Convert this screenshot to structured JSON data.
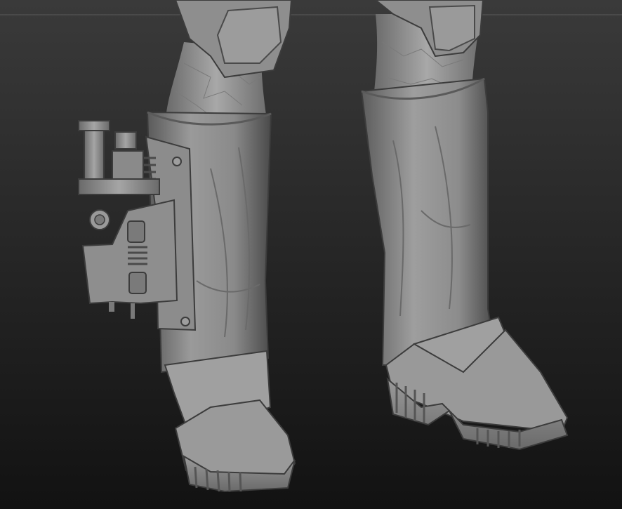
{
  "viewport": {
    "background_top": "#3a3a3a",
    "background_bottom": "#121212",
    "material_base": "#8a8a8a",
    "material_highlight": "#b5b5b5",
    "material_shadow": "#3c3c3c",
    "guide_line_color": "#5a5a5a"
  },
  "scene": {
    "subject": "sculpted-figure-lower-legs",
    "parts": [
      "left-boot",
      "right-boot",
      "holster",
      "blaster-pistol",
      "left-shin",
      "right-shin",
      "knee-armor-left",
      "knee-armor-right"
    ]
  }
}
